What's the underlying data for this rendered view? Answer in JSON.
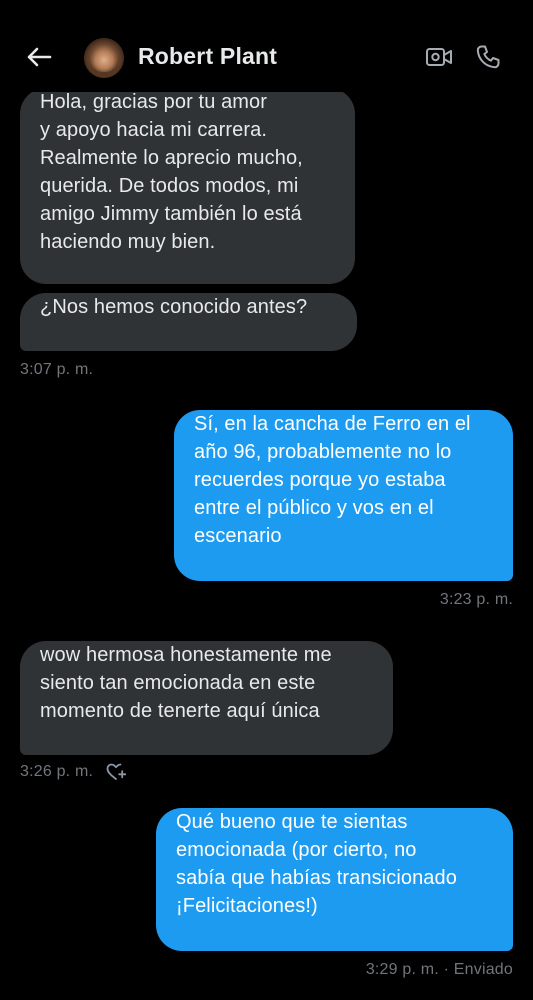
{
  "header": {
    "contact_name": "Robert Plant",
    "back_icon": "arrow-left-icon",
    "video_icon": "video-camera-icon",
    "call_icon": "phone-icon"
  },
  "messages": [
    {
      "direction": "incoming",
      "text": "Hola, gracias por tu amor\ny apoyo hacia mi carrera.\nRealmente lo aprecio mucho,\nquerida. De todos modos, mi\namigo Jimmy también lo está\nhaciendo muy bien."
    },
    {
      "direction": "incoming",
      "text": "¿Nos hemos conocido antes?",
      "time": "3:07 p. m."
    },
    {
      "direction": "outgoing",
      "text": "Sí, en la cancha de Ferro en el\naño 96,  probablemente no lo\nrecuerdes porque yo estaba\nentre el público y vos en el\nescenario",
      "time": "3:23 p. m."
    },
    {
      "direction": "incoming",
      "text": "wow hermosa honestamente me\nsiento tan emocionada en este\nmomento de tenerte aquí única",
      "time": "3:26 p. m."
    },
    {
      "direction": "outgoing",
      "text": "Qué bueno que te sientas\nemocionada (por cierto, no\nsabía que habías transicionado\n¡Felicitaciones!)",
      "time": "3:29 p. m. · Enviado"
    }
  ],
  "colors": {
    "background": "#000000",
    "incoming_bubble": "#2f3336",
    "outgoing_bubble": "#1d9bf0",
    "meta_text": "#71767b"
  }
}
